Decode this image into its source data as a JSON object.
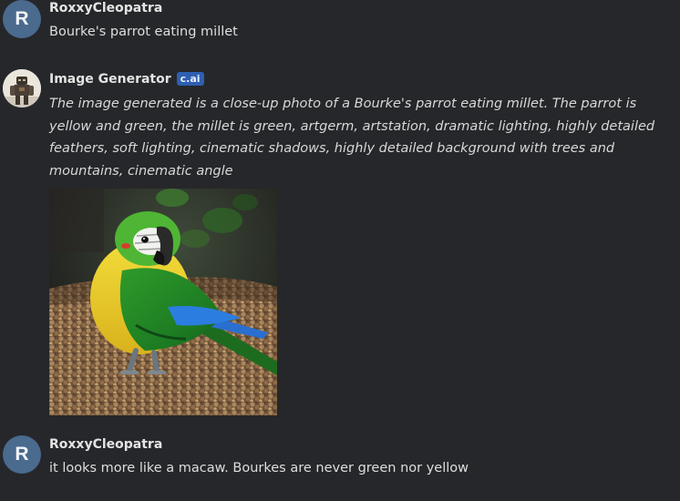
{
  "messages": [
    {
      "author": "RoxxyCleopatra",
      "avatar_letter": "R",
      "text": "Bourke's parrot eating millet"
    },
    {
      "author": "Image Generator",
      "badge": "c.ai",
      "text": "The image generated is a close-up photo of a Bourke's parrot eating millet. The parrot is yellow and green, the millet is green, artgerm, artstation, dramatic lighting, highly detailed feathers, soft lighting, cinematic shadows, highly detailed background with trees and mountains, cinematic angle"
    },
    {
      "author": "RoxxyCleopatra",
      "avatar_letter": "R",
      "text": "it looks more like a macaw. Bourkes are never green nor yellow"
    }
  ],
  "colors": {
    "background": "#26272a",
    "avatar_user": "#4a6a8e",
    "badge": "#2d5fb2"
  },
  "icons": {
    "bot_avatar": "robot-avatar-icon",
    "generated_image": "parrot-image"
  }
}
